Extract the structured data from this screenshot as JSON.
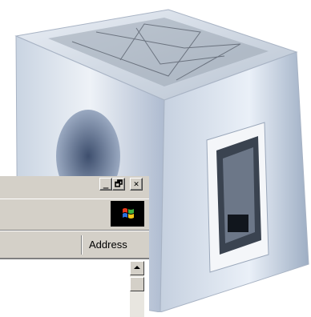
{
  "window": {
    "controls": {
      "minimize_icon": "_",
      "restore_icon": "🗗",
      "close_icon": "✕"
    }
  },
  "address_bar": {
    "label": "Address"
  },
  "icons": {
    "throbber": "windows-flag-icon",
    "scroll_up": "arrow-up-icon"
  },
  "colors": {
    "chrome": "#d4d0c8",
    "throbber_bg": "#000000",
    "content_bg": "#ffffff"
  }
}
